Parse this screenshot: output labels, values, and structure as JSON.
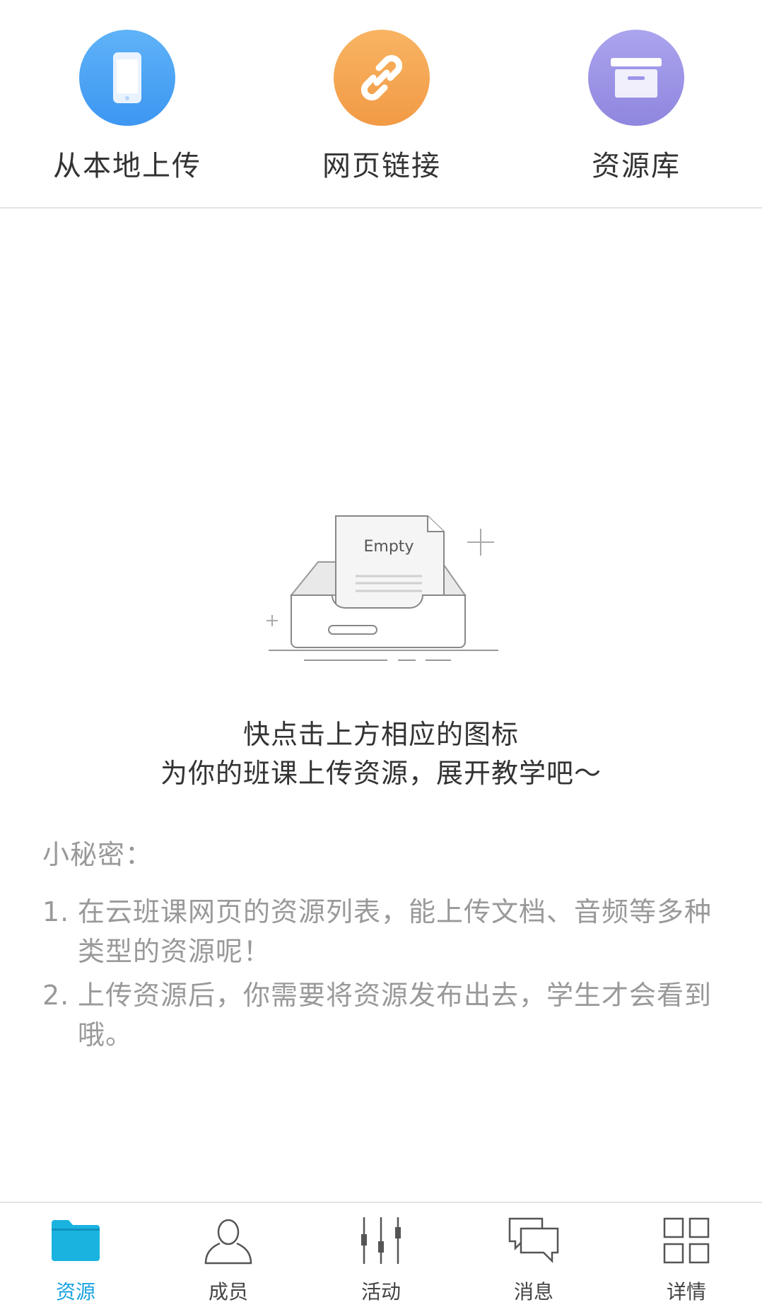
{
  "top_actions": {
    "local": {
      "label": "从本地上传",
      "icon": "phone-icon",
      "color": "#4aa6f5"
    },
    "link": {
      "label": "网页链接",
      "icon": "link-icon",
      "color": "#f6a352"
    },
    "library": {
      "label": "资源库",
      "icon": "archive-box-icon",
      "color": "#9d95e6"
    }
  },
  "empty_state": {
    "illustration_text": "Empty",
    "line1": "快点击上方相应的图标",
    "line2": "为你的班课上传资源，展开教学吧～"
  },
  "secret": {
    "title": "小秘密：",
    "tips": [
      {
        "num": "1.",
        "text": "在云班课网页的资源列表，能上传文档、音频等多种类型的资源呢！"
      },
      {
        "num": "2.",
        "text": "上传资源后，你需要将资源发布出去，学生才会看到哦。"
      }
    ]
  },
  "tabbar": {
    "active_color": "#1aa3e0",
    "items": [
      {
        "label": "资源",
        "icon": "folder-icon",
        "active": true
      },
      {
        "label": "成员",
        "icon": "person-icon",
        "active": false
      },
      {
        "label": "活动",
        "icon": "sliders-icon",
        "active": false
      },
      {
        "label": "消息",
        "icon": "chat-bubbles-icon",
        "active": false
      },
      {
        "label": "详情",
        "icon": "grid-icon",
        "active": false
      }
    ]
  }
}
